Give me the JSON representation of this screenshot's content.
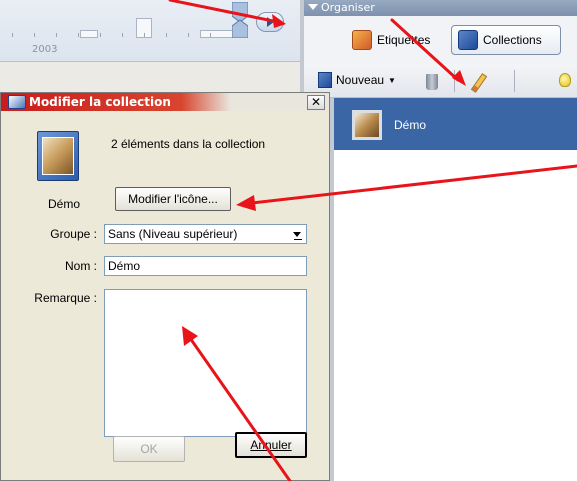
{
  "timeline": {
    "year_label": "2003"
  },
  "organizer": {
    "header_label": "Organiser",
    "tabs": [
      {
        "label": "Etiquettes",
        "icon": "tag-icon"
      },
      {
        "label": "Collections",
        "icon": "collection-icon",
        "selected": true
      }
    ],
    "toolbar": {
      "new_label": "Nouveau"
    },
    "list": [
      {
        "name": "Démo",
        "selected": true
      }
    ]
  },
  "dialog": {
    "title": "Modifier la collection",
    "collection_name": "Démo",
    "elements_count_text": "2 éléments dans la collection",
    "change_icon_button": "Modifier l'icône...",
    "fields": {
      "groupe_label": "Groupe :",
      "groupe_value": "Sans (Niveau supérieur)",
      "nom_label": "Nom :",
      "nom_value": "Démo",
      "remarque_label": "Remarque :",
      "remarque_value": ""
    },
    "buttons": {
      "ok": "OK",
      "cancel": "Annuler"
    }
  },
  "colors": {
    "annotation_arrow": "#e8141a",
    "selection": "#3a66a5",
    "title_bar": "#c81d1d"
  }
}
